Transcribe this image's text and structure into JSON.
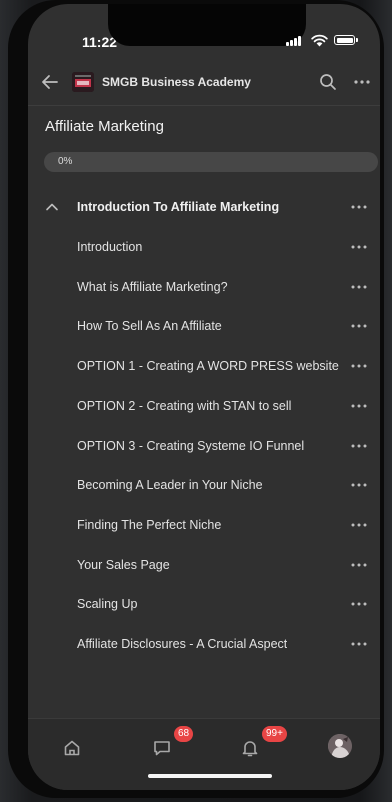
{
  "status_bar": {
    "time": "11:22"
  },
  "header": {
    "academy_name": "SMGB Business Academy",
    "back_icon": "arrow-left-icon",
    "search_icon": "search-icon",
    "more_icon": "more-horizontal-icon"
  },
  "course": {
    "title": "Affiliate Marketing",
    "progress_label": "0%",
    "progress_percent": 0
  },
  "module": {
    "title": "Introduction To Affiliate Marketing",
    "expanded": true
  },
  "lessons": [
    {
      "title": "Introduction"
    },
    {
      "title": "What is Affiliate Marketing?"
    },
    {
      "title": "How To Sell As An Affiliate"
    },
    {
      "title": "OPTION 1 - Creating A WORD PRESS website"
    },
    {
      "title": "OPTION 2 - Creating with STAN to sell"
    },
    {
      "title": "OPTION 3 - Creating Systeme IO Funnel"
    },
    {
      "title": "Becoming A Leader in Your Niche"
    },
    {
      "title": "Finding The Perfect Niche"
    },
    {
      "title": "Your Sales Page"
    },
    {
      "title": "Scaling Up"
    },
    {
      "title": "Affiliate Disclosures - A Crucial Aspect"
    }
  ],
  "tabbar": {
    "chat_badge": "68",
    "notifications_badge": "99+"
  },
  "colors": {
    "screen_bg": "#303030",
    "badge": "#e84545",
    "text": "#e3e3e3"
  }
}
